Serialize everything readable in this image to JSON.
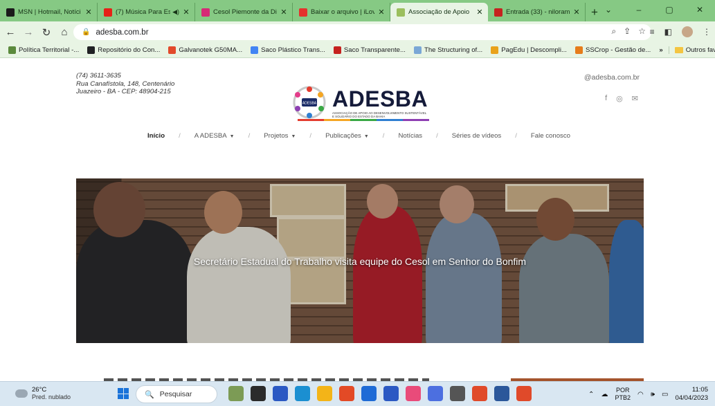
{
  "browser": {
    "tabs": [
      {
        "title": "MSN | Hotmail, Notíci",
        "favicon_color": "#1b1b1b",
        "active": false
      },
      {
        "title": "(7) Música Para Es",
        "favicon_color": "#e62117",
        "active": false,
        "audio": "◀)"
      },
      {
        "title": "Cesol Piemonte da Di",
        "favicon_color": "#d62976",
        "active": false
      },
      {
        "title": "Baixar o arquivo | iLov",
        "favicon_color": "#e5322d",
        "active": false
      },
      {
        "title": "Associação de Apoio",
        "favicon_color": "#9bbf5d",
        "active": true
      },
      {
        "title": "Entrada (33) - niloram",
        "favicon_color": "#c5221f",
        "active": false
      }
    ],
    "new_tab_label": "+",
    "window_controls": [
      "⌄",
      "–",
      "▢",
      "✕"
    ],
    "url": "adesba.com.br",
    "bookmarks": [
      {
        "label": "Política Territorial -...",
        "color": "#5b8a3c"
      },
      {
        "label": "Repositório do Con...",
        "color": "#202124"
      },
      {
        "label": "Galvanotek G50MA...",
        "color": "#e24a2b"
      },
      {
        "label": "Saco Plástico Trans...",
        "color": "#4285f4"
      },
      {
        "label": "Saco Transparente...",
        "color": "#c5221f"
      },
      {
        "label": "The Structuring of...",
        "color": "#7aa7d6"
      },
      {
        "label": "PagEdu | Descompli...",
        "color": "#e9a21b"
      },
      {
        "label": "SSCrop - Gestão de...",
        "color": "#e67c1b"
      }
    ],
    "bookmarks_more": "»",
    "other_bookmarks": "Outros favoritos"
  },
  "site": {
    "contact": {
      "phone": "(74) 3611-3635",
      "street": "Rua Canafístola, 148, Centenário",
      "city": "Juazeiro - BA - CEP: 48904-215"
    },
    "logo": {
      "name": "ADESBA",
      "subtitle": "ASSOCIAÇÃO DE APOIO AO DESENVOLVIMENTO SUSTENTÁVEL E SOLIDÁRIO DO ESTADO DA BAHIA",
      "badge": "ADESBA"
    },
    "email": "@adesba.com.br",
    "nav": [
      {
        "label": "Início",
        "active": true,
        "dropdown": false
      },
      {
        "label": "A ADESBA",
        "active": false,
        "dropdown": true
      },
      {
        "label": "Projetos",
        "active": false,
        "dropdown": true
      },
      {
        "label": "Publicações",
        "active": false,
        "dropdown": true
      },
      {
        "label": "Notícias",
        "active": false,
        "dropdown": false
      },
      {
        "label": "Séries de vídeos",
        "active": false,
        "dropdown": false
      },
      {
        "label": "Fale conosco",
        "active": false,
        "dropdown": false
      }
    ],
    "nav_separator": "/",
    "hero_caption": "Secretário Estadual do Trabalho visita equipe do Cesol em Senhor do Bonfim"
  },
  "taskbar": {
    "weather_temp": "26°C",
    "weather_desc": "Pred. nublado",
    "search_placeholder": "Pesquisar",
    "lang_top": "POR",
    "lang_bottom": "PTB2",
    "time": "11:05",
    "date": "04/04/2023",
    "app_colors": [
      "#7c9b55",
      "#2b2b2b",
      "#2b59c3",
      "#1b8fd1",
      "#f3b418",
      "#e34a26",
      "#1e6bd6",
      "#2b59c3",
      "#e94b7a",
      "#4c6fe0",
      "#555555",
      "#e04a2a",
      "#2b579a",
      "#e04a2a"
    ]
  }
}
